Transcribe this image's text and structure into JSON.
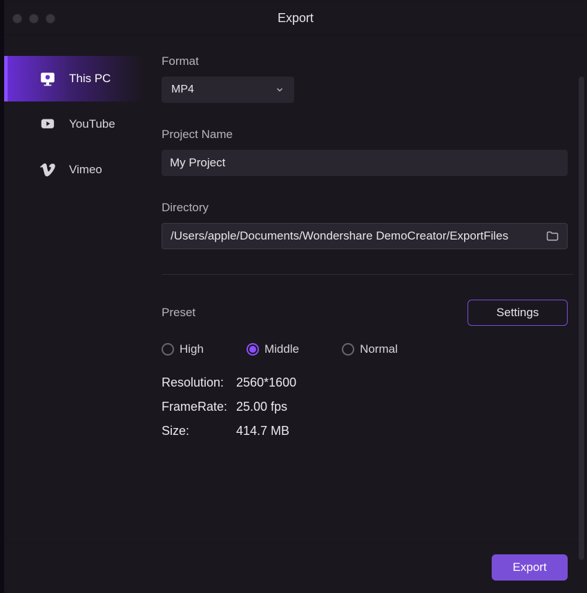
{
  "title": "Export",
  "sidebar": {
    "items": [
      {
        "label": "This PC"
      },
      {
        "label": "YouTube"
      },
      {
        "label": "Vimeo"
      }
    ]
  },
  "format": {
    "label": "Format",
    "value": "MP4"
  },
  "project_name": {
    "label": "Project Name",
    "value": "My Project"
  },
  "directory": {
    "label": "Directory",
    "value": "/Users/apple/Documents/Wondershare DemoCreator/ExportFiles"
  },
  "preset": {
    "label": "Preset",
    "settings_label": "Settings",
    "options": {
      "high": "High",
      "middle": "Middle",
      "normal": "Normal"
    },
    "selected": "middle"
  },
  "specs": {
    "resolution_label": "Resolution:",
    "resolution_value": "2560*1600",
    "framerate_label": "FrameRate:",
    "framerate_value": "25.00 fps",
    "size_label": "Size:",
    "size_value": "414.7 MB"
  },
  "export_button": "Export"
}
